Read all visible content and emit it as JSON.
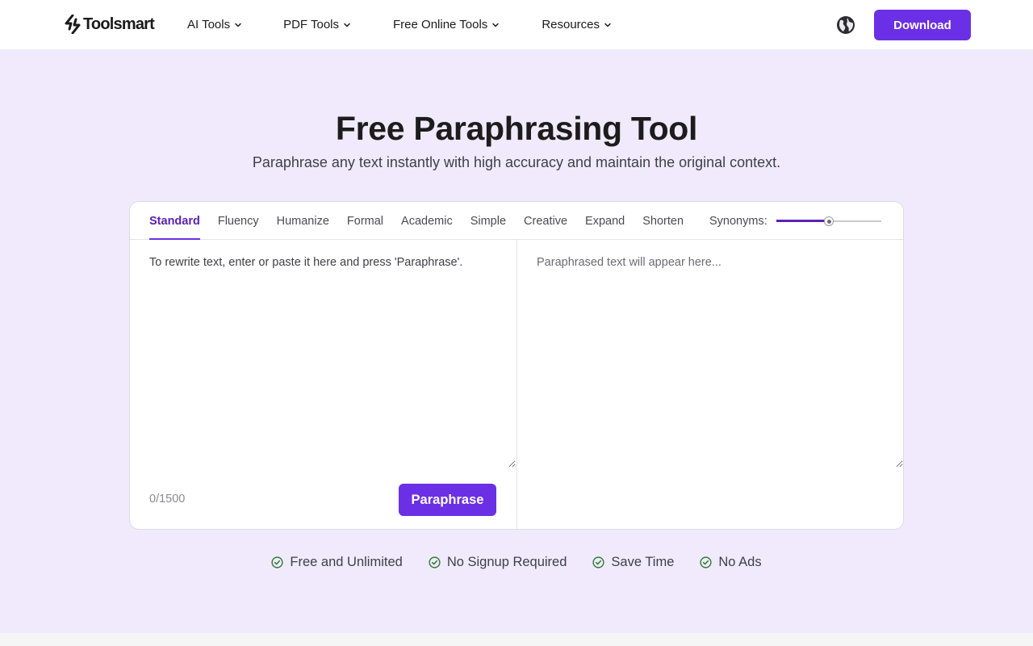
{
  "brand": {
    "name": "Toolsmart"
  },
  "nav": {
    "items": [
      {
        "label": "AI Tools"
      },
      {
        "label": "PDF Tools"
      },
      {
        "label": "Free Online Tools"
      },
      {
        "label": "Resources"
      }
    ],
    "language_icon": "globe-icon",
    "download_label": "Download"
  },
  "hero": {
    "title": "Free Paraphrasing Tool",
    "subtitle": "Paraphrase any text instantly with high accuracy and maintain the original context."
  },
  "tool": {
    "modes": [
      {
        "label": "Standard",
        "active": true
      },
      {
        "label": "Fluency",
        "active": false
      },
      {
        "label": "Humanize",
        "active": false
      },
      {
        "label": "Formal",
        "active": false
      },
      {
        "label": "Academic",
        "active": false
      },
      {
        "label": "Simple",
        "active": false
      },
      {
        "label": "Creative",
        "active": false
      },
      {
        "label": "Expand",
        "active": false
      },
      {
        "label": "Shorten",
        "active": false
      }
    ],
    "synonyms_label": "Synonyms:",
    "synonyms_level": 0.5,
    "input": {
      "value": "",
      "placeholder": "To rewrite text, enter or paste it here and press 'Paraphrase'."
    },
    "output": {
      "value": "",
      "placeholder": "Paraphrased text will appear here..."
    },
    "char_count": "0/1500",
    "paraphrase_label": "Paraphrase"
  },
  "features": [
    {
      "label": "Free and Unlimited",
      "icon": "check-circle-icon"
    },
    {
      "label": "No Signup Required",
      "icon": "check-circle-icon"
    },
    {
      "label": "Save Time",
      "icon": "check-circle-icon"
    },
    {
      "label": "No Ads",
      "icon": "check-circle-icon"
    }
  ],
  "colors": {
    "accent": "#6b2fe6",
    "accent_dark": "#5b21b6",
    "hero_bg": "#f0eafc",
    "check": "#2e7d32"
  }
}
